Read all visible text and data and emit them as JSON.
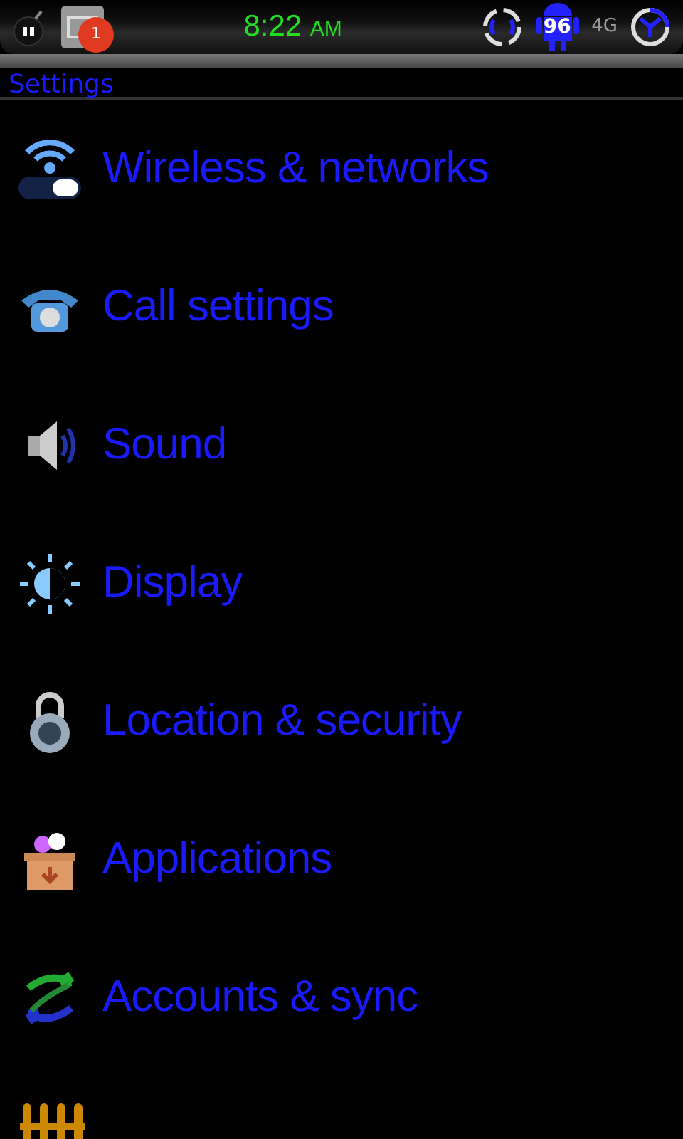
{
  "status_bar": {
    "notification_count": "1",
    "time": "8:22",
    "ampm": "AM",
    "battery": "96",
    "network": "4G"
  },
  "title": "Settings",
  "items": [
    {
      "kind": "full",
      "label": "Wireless & networks"
    },
    {
      "kind": "full",
      "label": "Call settings"
    },
    {
      "kind": "full",
      "label": "Sound"
    },
    {
      "kind": "full",
      "label": "Display"
    },
    {
      "kind": "full",
      "label": "Location & security"
    },
    {
      "kind": "full",
      "label": "Applications"
    },
    {
      "kind": "full",
      "label": "Accounts & sync"
    },
    {
      "kind": "partial"
    }
  ]
}
